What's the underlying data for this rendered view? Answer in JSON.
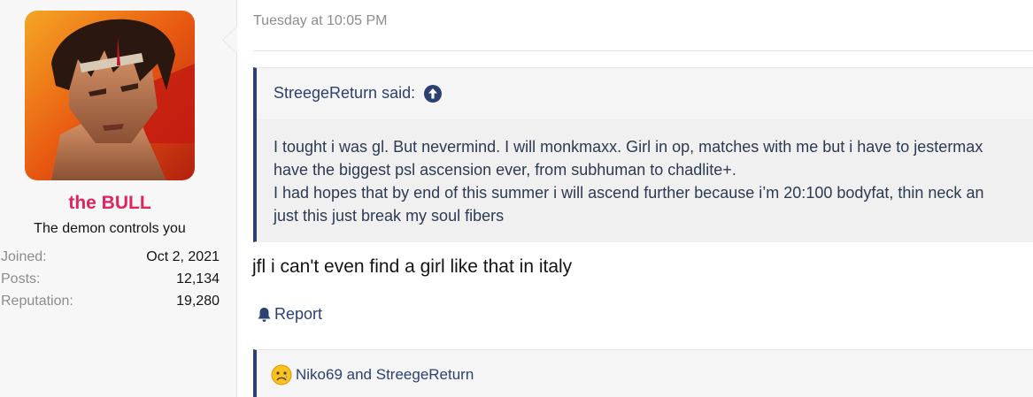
{
  "user": {
    "name": "the BULL",
    "title": "The demon controls you",
    "stats": [
      {
        "label": "Joined:",
        "value": "Oct 2, 2021"
      },
      {
        "label": "Posts:",
        "value": "12,134"
      },
      {
        "label": "Reputation:",
        "value": "19,280"
      }
    ]
  },
  "post": {
    "date": "Tuesday at 10:05 PM",
    "quote": {
      "author_said": "StreegeReturn said:",
      "lines": [
        "I tought i was gl. But nevermind. I will monkmaxx. Girl in op, matches with me but i have to jestermax",
        "have the biggest psl ascension ever, from subhuman to chadlite+.",
        "I had hopes that by end of this summer i will ascend further because i’m 20:100 bodyfat, thin neck an",
        "just this just break my soul fibers"
      ]
    },
    "message": "jfl i can't even find a girl like that in italy",
    "report_label": "Report",
    "reactions_text": "Niko69 and StreegeReturn"
  },
  "colors": {
    "username": "#e0245e",
    "link": "#2c4071",
    "quote_border": "#2c4071"
  },
  "icons": {
    "quote_jump": "arrow-up-circle-icon",
    "report": "bell-icon",
    "reaction": "sad-face-icon"
  }
}
